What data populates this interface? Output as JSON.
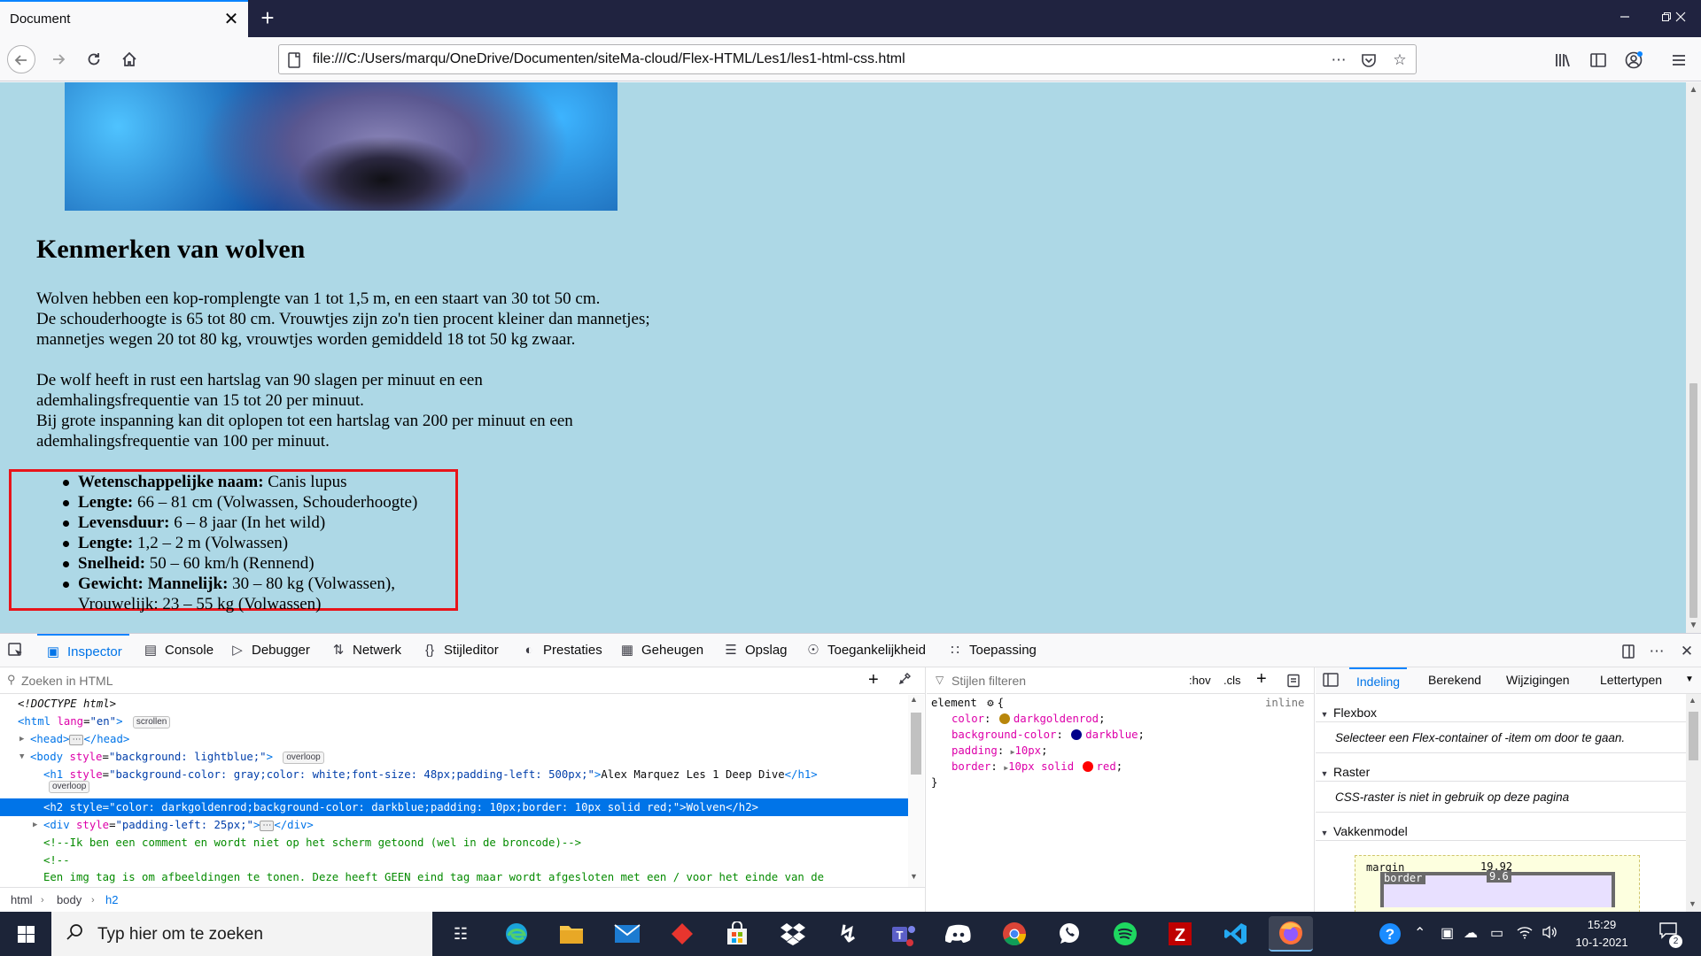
{
  "browser": {
    "tab_title": "Document",
    "tab_close": "✕",
    "new_tab": "+",
    "url": "file:///C:/Users/marqu/OneDrive/Documenten/siteMa-cloud/Flex-HTML/Les1/les1-html-css.html",
    "url_actions": [
      "page-actions-icon",
      "pocket-icon",
      "bookmark-star-icon"
    ],
    "window_controls": [
      "minimize",
      "restore",
      "close"
    ]
  },
  "page": {
    "heading": "Kenmerken van wolven",
    "paragraph1": [
      "Wolven hebben een kop-romplengte van 1 tot 1,5 m, en een staart van 30 tot 50 cm.",
      "De schouderhoogte is 65 tot 80 cm. Vrouwtjes zijn zo'n tien procent kleiner dan mannetjes;",
      "mannetjes wegen 20 tot 80 kg, vrouwtjes worden gemiddeld 18 tot 50 kg zwaar."
    ],
    "paragraph2": [
      "De wolf heeft in rust een hartslag van 90 slagen per minuut en een",
      "ademhalingsfrequentie van 15 tot 20 per minuut.",
      "Bij grote inspanning kan dit oplopen tot een hartslag van 200 per minuut en een",
      "ademhalingsfrequentie van 100 per minuut."
    ],
    "facts": [
      {
        "label": "Wetenschappelijke naam:",
        "value": " Canis lupus"
      },
      {
        "label": "Lengte:",
        "value": " 66 – 81 cm (Volwassen, Schouderhoogte)"
      },
      {
        "label": "Levensduur:",
        "value": " 6 – 8 jaar (In het wild)"
      },
      {
        "label": "Lengte:",
        "value": " 1,2 – 2 m (Volwassen)"
      },
      {
        "label": "Snelheid:",
        "value": " 50 – 60 km/h (Rennend)"
      },
      {
        "label": "Gewicht: Mannelijk:",
        "value": " 30 – 80 kg (Volwassen),",
        "value2": "Vrouwelijk: 23 – 55 kg (Volwassen)"
      }
    ],
    "accent_box_color": "#e8141a",
    "background_color": "lightblue"
  },
  "devtools": {
    "tabs": [
      {
        "label": "Inspector",
        "icon": "inspector-icon",
        "active": true
      },
      {
        "label": "Console",
        "icon": "console-icon"
      },
      {
        "label": "Debugger",
        "icon": "debugger-icon"
      },
      {
        "label": "Netwerk",
        "icon": "network-icon"
      },
      {
        "label": "Stijleditor",
        "icon": "style-editor-icon"
      },
      {
        "label": "Prestaties",
        "icon": "performance-icon"
      },
      {
        "label": "Geheugen",
        "icon": "memory-icon"
      },
      {
        "label": "Opslag",
        "icon": "storage-icon"
      },
      {
        "label": "Toegankelijkheid",
        "icon": "accessibility-icon"
      },
      {
        "label": "Toepassing",
        "icon": "application-icon"
      }
    ],
    "search_placeholder": "Zoeken in HTML",
    "markup": {
      "doctype": "<!DOCTYPE html>",
      "html_tag": "html",
      "html_attr": "lang",
      "html_val": "\"en\"",
      "badge_scroll": "scrollen",
      "head_tag": "head",
      "body_tag": "body",
      "body_attr": "style",
      "body_val": "\"background: lightblue;\"",
      "badge_overflow": "overloop",
      "h1_tag": "h1",
      "h1_attr": "style",
      "h1_val": "\"background-color: gray;color: white;font-size: 48px;padding-left: 500px;\"",
      "h1_text": "Alex Marquez Les 1 Deep Dive",
      "h2_tag": "h2",
      "h2_attr": "style",
      "h2_val": "\"color: darkgoldenrod;background-color: darkblue;padding: 10px;border: 10px solid red;\"",
      "h2_text": "Wolven",
      "div_tag": "div",
      "div_attr": "style",
      "div_val": "\"padding-left: 25px;\"",
      "comment1": "<!--Ik ben een comment en wordt niet op het scherm getoond (wel in de broncode)-->",
      "comment2": "<!--",
      "comment3": "Een img tag is om afbeeldingen te tonen. Deze heeft GEEN eind tag maar wordt afgesloten met een / voor het einde van de"
    },
    "breadcrumbs": [
      "html",
      "body",
      "h2"
    ],
    "rules": {
      "filter_placeholder": "Stijlen filteren",
      "hov": ":hov",
      "cls": ".cls",
      "selector": "element",
      "inline": "inline",
      "props": [
        {
          "name": "color",
          "value": "darkgoldenrod",
          "swatch": "#b8860b"
        },
        {
          "name": "background-color",
          "value": "darkblue",
          "swatch": "#00008b"
        },
        {
          "name": "padding",
          "value": "10px"
        },
        {
          "name": "border",
          "value": "10px solid",
          "value_kw": "red",
          "swatch": "#ff0000"
        }
      ]
    },
    "layout": {
      "tabs": [
        "Indeling",
        "Berekend",
        "Wijzigingen",
        "Lettertypen"
      ],
      "flexbox_title": "Flexbox",
      "flexbox_note": "Selecteer een Flex-container of -item om door te gaan.",
      "grid_title": "Raster",
      "grid_note": "CSS-raster is niet in gebruik op deze pagina",
      "boxmodel_title": "Vakkenmodel",
      "margin_label": "margin",
      "margin_value": "19.92",
      "border_label": "border",
      "border_value": "9.6"
    }
  },
  "taskbar": {
    "search_placeholder": "Typ hier om te zoeken",
    "time": "15:29",
    "date": "10-1-2021",
    "notification_count": "2"
  }
}
